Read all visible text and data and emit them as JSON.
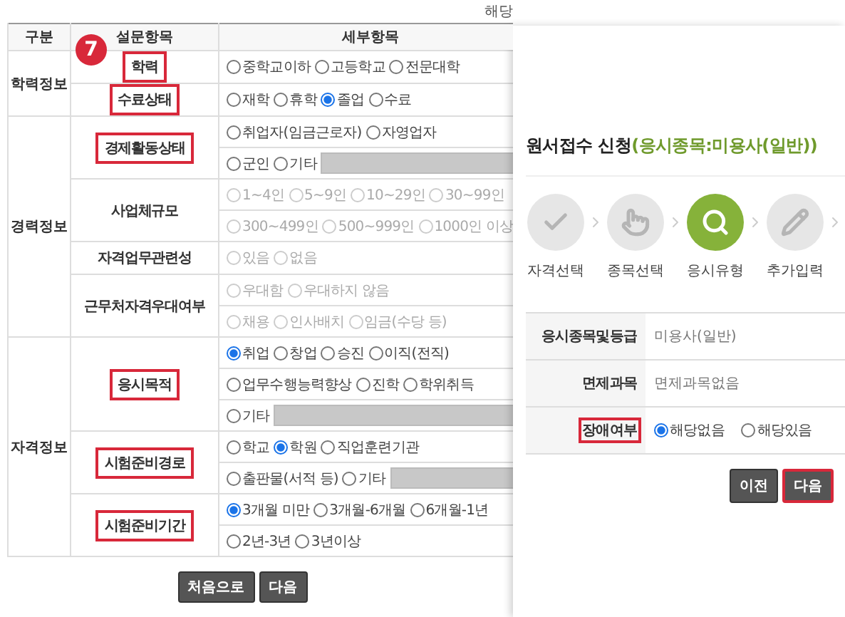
{
  "left": {
    "note": "해당",
    "step_badge": "7",
    "columns": [
      "구분",
      "설문항목",
      "세부항목"
    ],
    "groups": [
      {
        "name": "학력정보",
        "items": [
          {
            "label": "학력",
            "highlighted": true,
            "disabled": false,
            "lines": [
              [
                {
                  "kind": "radio",
                  "label": "중학교이하",
                  "selected": false
                },
                {
                  "kind": "radio",
                  "label": "고등학교",
                  "selected": false
                },
                {
                  "kind": "radio",
                  "label": "전문대학",
                  "selected": false
                }
              ]
            ]
          },
          {
            "label": "수료상태",
            "highlighted": true,
            "disabled": false,
            "lines": [
              [
                {
                  "kind": "radio",
                  "label": "재학",
                  "selected": false
                },
                {
                  "kind": "radio",
                  "label": "휴학",
                  "selected": false
                },
                {
                  "kind": "radio",
                  "label": "졸업",
                  "selected": true
                },
                {
                  "kind": "radio",
                  "label": "수료",
                  "selected": false
                }
              ]
            ]
          }
        ]
      },
      {
        "name": "경력정보",
        "items": [
          {
            "label": "경제활동상태",
            "highlighted": true,
            "disabled": false,
            "lines": [
              [
                {
                  "kind": "radio",
                  "label": "취업자(임금근로자)",
                  "selected": false
                },
                {
                  "kind": "radio",
                  "label": "자영업자",
                  "selected": false
                }
              ],
              [
                {
                  "kind": "radio",
                  "label": "군인",
                  "selected": false
                },
                {
                  "kind": "other",
                  "label": "기타",
                  "selected": false
                }
              ]
            ]
          },
          {
            "label": "사업체규모",
            "highlighted": false,
            "disabled": true,
            "lines": [
              [
                {
                  "kind": "radio",
                  "label": "1~4인",
                  "selected": false
                },
                {
                  "kind": "radio",
                  "label": "5~9인",
                  "selected": false
                },
                {
                  "kind": "radio",
                  "label": "10~29인",
                  "selected": false
                },
                {
                  "kind": "radio",
                  "label": "30~99인",
                  "selected": false
                }
              ],
              [
                {
                  "kind": "radio",
                  "label": "300~499인",
                  "selected": false
                },
                {
                  "kind": "radio",
                  "label": "500~999인",
                  "selected": false
                },
                {
                  "kind": "radio",
                  "label": "1000인 이상",
                  "selected": false
                }
              ]
            ]
          },
          {
            "label": "자격업무관련성",
            "highlighted": false,
            "disabled": true,
            "lines": [
              [
                {
                  "kind": "radio",
                  "label": "있음",
                  "selected": false
                },
                {
                  "kind": "radio",
                  "label": "없음",
                  "selected": false
                }
              ]
            ]
          },
          {
            "label": "근무처자격우대여부",
            "highlighted": false,
            "disabled": true,
            "lines": [
              [
                {
                  "kind": "radio",
                  "label": "우대함",
                  "selected": false
                },
                {
                  "kind": "radio",
                  "label": "우대하지 않음",
                  "selected": false
                }
              ],
              [
                {
                  "kind": "radio",
                  "label": "채용",
                  "selected": false
                },
                {
                  "kind": "radio",
                  "label": "인사배치",
                  "selected": false
                },
                {
                  "kind": "radio",
                  "label": "임금(수당 등)",
                  "selected": false
                }
              ]
            ]
          }
        ]
      },
      {
        "name": "자격정보",
        "items": [
          {
            "label": "응시목적",
            "highlighted": true,
            "disabled": false,
            "lines": [
              [
                {
                  "kind": "radio",
                  "label": "취업",
                  "selected": true
                },
                {
                  "kind": "radio",
                  "label": "창업",
                  "selected": false
                },
                {
                  "kind": "radio",
                  "label": "승진",
                  "selected": false
                },
                {
                  "kind": "radio",
                  "label": "이직(전직)",
                  "selected": false
                }
              ],
              [
                {
                  "kind": "radio",
                  "label": "업무수행능력향상",
                  "selected": false
                },
                {
                  "kind": "radio",
                  "label": "진학",
                  "selected": false
                },
                {
                  "kind": "radio",
                  "label": "학위취득",
                  "selected": false
                }
              ],
              [
                {
                  "kind": "other",
                  "label": "기타",
                  "selected": false
                }
              ]
            ]
          },
          {
            "label": "시험준비경로",
            "highlighted": true,
            "disabled": false,
            "lines": [
              [
                {
                  "kind": "radio",
                  "label": "학교",
                  "selected": false
                },
                {
                  "kind": "radio",
                  "label": "학원",
                  "selected": true
                },
                {
                  "kind": "radio",
                  "label": "직업훈련기관",
                  "selected": false
                }
              ],
              [
                {
                  "kind": "radio",
                  "label": "출판물(서적 등)",
                  "selected": false
                },
                {
                  "kind": "other",
                  "label": "기타",
                  "selected": false
                }
              ]
            ]
          },
          {
            "label": "시험준비기간",
            "highlighted": true,
            "disabled": false,
            "lines": [
              [
                {
                  "kind": "radio",
                  "label": "3개월 미만",
                  "selected": true
                },
                {
                  "kind": "radio",
                  "label": "3개월-6개월",
                  "selected": false
                },
                {
                  "kind": "radio",
                  "label": "6개월-1년",
                  "selected": false
                }
              ],
              [
                {
                  "kind": "radio",
                  "label": "2년-3년",
                  "selected": false
                },
                {
                  "kind": "radio",
                  "label": "3년이상",
                  "selected": false
                }
              ]
            ]
          }
        ]
      }
    ],
    "buttons": [
      {
        "label": "처음으로",
        "highlighted": false
      },
      {
        "label": "다음",
        "highlighted": false
      }
    ]
  },
  "right": {
    "title": "원서접수 신청",
    "subtitle": "(응시종목:미용사(일반))",
    "steps": [
      {
        "label": "자격선택",
        "active": false
      },
      {
        "label": "종목선택",
        "active": false
      },
      {
        "label": "응시유형",
        "active": true
      },
      {
        "label": "추가입력",
        "active": false
      }
    ],
    "rows": [
      {
        "kind": "text",
        "label": "응시종목및등급",
        "value": "미용사(일반)",
        "highlighted": false
      },
      {
        "kind": "text",
        "label": "면제과목",
        "value": "면제과목없음",
        "highlighted": false
      },
      {
        "kind": "radio",
        "label": "장애여부",
        "highlighted": true,
        "options": [
          {
            "label": "해당없음",
            "selected": true
          },
          {
            "label": "해당있음",
            "selected": false
          }
        ]
      }
    ],
    "buttons": [
      {
        "label": "이전",
        "highlighted": false
      },
      {
        "label": "다음",
        "highlighted": true
      }
    ]
  }
}
